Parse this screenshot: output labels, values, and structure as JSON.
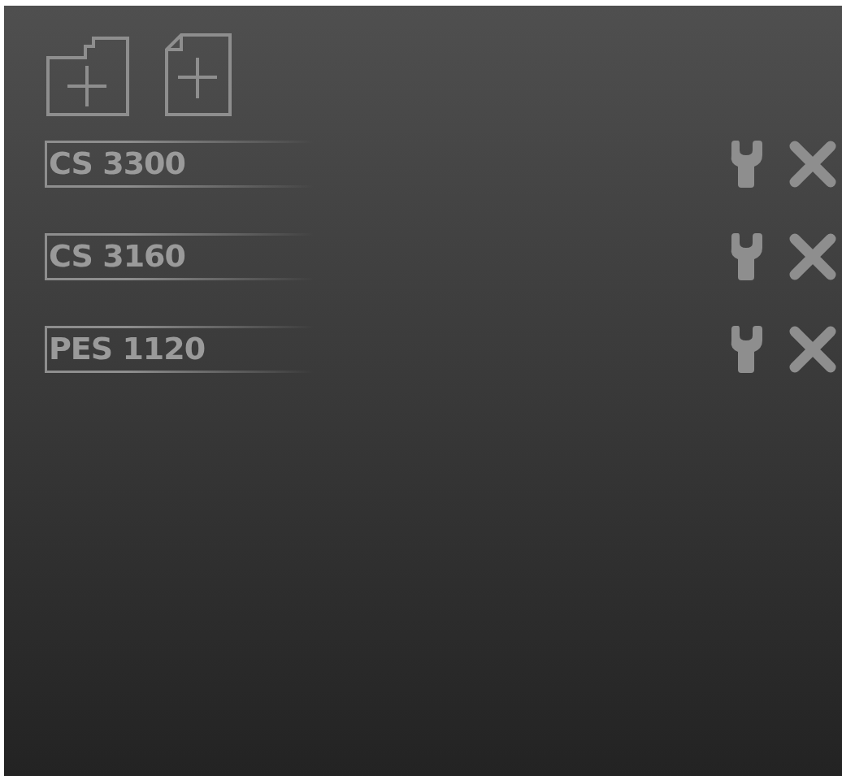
{
  "toolbar": {
    "buttons": [
      {
        "kind": "new-folder"
      },
      {
        "kind": "new-file"
      }
    ]
  },
  "items": [
    {
      "label": "CS 3300"
    },
    {
      "label": "CS 3160"
    },
    {
      "label": "PES 1120"
    }
  ]
}
